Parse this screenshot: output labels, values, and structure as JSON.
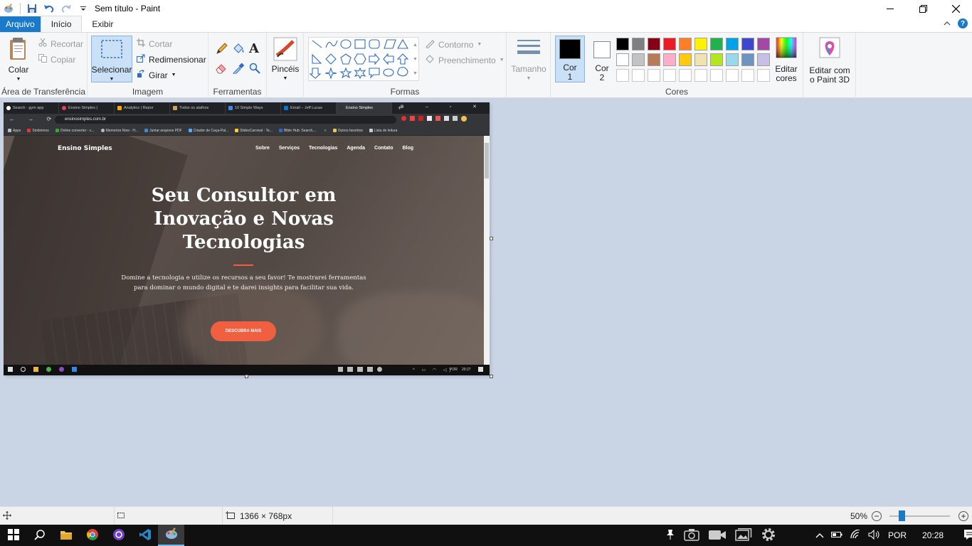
{
  "window": {
    "title": "Sem título - Paint",
    "controls": [
      "minimize",
      "restore",
      "close"
    ]
  },
  "ribbon_tabs": [
    {
      "label": "Arquivo"
    },
    {
      "label": "Início"
    },
    {
      "label": "Exibir"
    }
  ],
  "clipboard": {
    "paste": "Colar",
    "cut": "Recortar",
    "copy": "Copiar",
    "group": "Área de Transferência"
  },
  "image": {
    "select": "Selecionar",
    "crop": "Cortar",
    "resize": "Redimensionar",
    "rotate": "Girar",
    "group": "Imagem"
  },
  "tools": {
    "group": "Ferramentas",
    "items": [
      "pencil-icon",
      "fill-icon",
      "text-icon",
      "eraser-icon",
      "color-picker-icon",
      "magnifier-icon"
    ]
  },
  "brushes": {
    "label": "Pincéis"
  },
  "shapes": {
    "outline": "Contorno",
    "fill": "Preenchimento",
    "group": "Formas"
  },
  "size": {
    "label": "Tamanho"
  },
  "colors": {
    "color1": "Cor 1",
    "color2": "Cor 2",
    "edit": "Editar cores",
    "group": "Cores",
    "color1_value": "#000000",
    "color2_value": "#ffffff",
    "palette_row1": [
      "#000000",
      "#7f7f7f",
      "#880015",
      "#ed1c24",
      "#ff7f27",
      "#fff200",
      "#22b14c",
      "#00a2e8",
      "#3f48cc",
      "#a349a4"
    ],
    "palette_row2": [
      "#ffffff",
      "#c3c3c3",
      "#b97a57",
      "#ffaec9",
      "#ffc90e",
      "#efe4b0",
      "#b5e61d",
      "#99d9ea",
      "#7092be",
      "#c8bfe7"
    ]
  },
  "paint3d": {
    "label": "Editar com o Paint 3D"
  },
  "canvas_image": {
    "browser_tabs": [
      "Search · gym app",
      "Ensino Simples (",
      "Analytics | Repor",
      "Todos os atalhos",
      "10 Simple Ways",
      "Email – Jeff Lucas",
      "Ensino Simples"
    ],
    "url": "ensinosimples.com.br",
    "bookmarks": [
      "Apps",
      "Sinônimos",
      "Online converter - c...",
      "Memorize Now - H...",
      "Juntar arquivos PDF",
      "Criador de Caça-Pal...",
      "SlidesCarnival - Te...",
      "Bible Hub: Search,...",
      "Outros favoritos",
      "Lista de leitura"
    ],
    "site": {
      "brand": "Ensino Simples",
      "nav": [
        "Sobre",
        "Serviços",
        "Tecnologias",
        "Agenda",
        "Contato",
        "Blog"
      ],
      "hero_title": "Seu Consultor em Inovação e Novas Tecnologias",
      "subtitle": "Domine a tecnologia e utilize os recursos a seu favor! Te mostrarei ferramentas para dominar o mundo digital e te darei insights para facilitar sua vida.",
      "cta": "DESCUBRA MAIS"
    },
    "inner_taskbar": {
      "lang": "POR",
      "time": "20:27"
    }
  },
  "statusbar": {
    "dimensions": "1366 × 768px",
    "zoom": "50%",
    "zoom_level": 0.2
  },
  "taskbar": {
    "lang": "POR",
    "time": "20:28"
  }
}
